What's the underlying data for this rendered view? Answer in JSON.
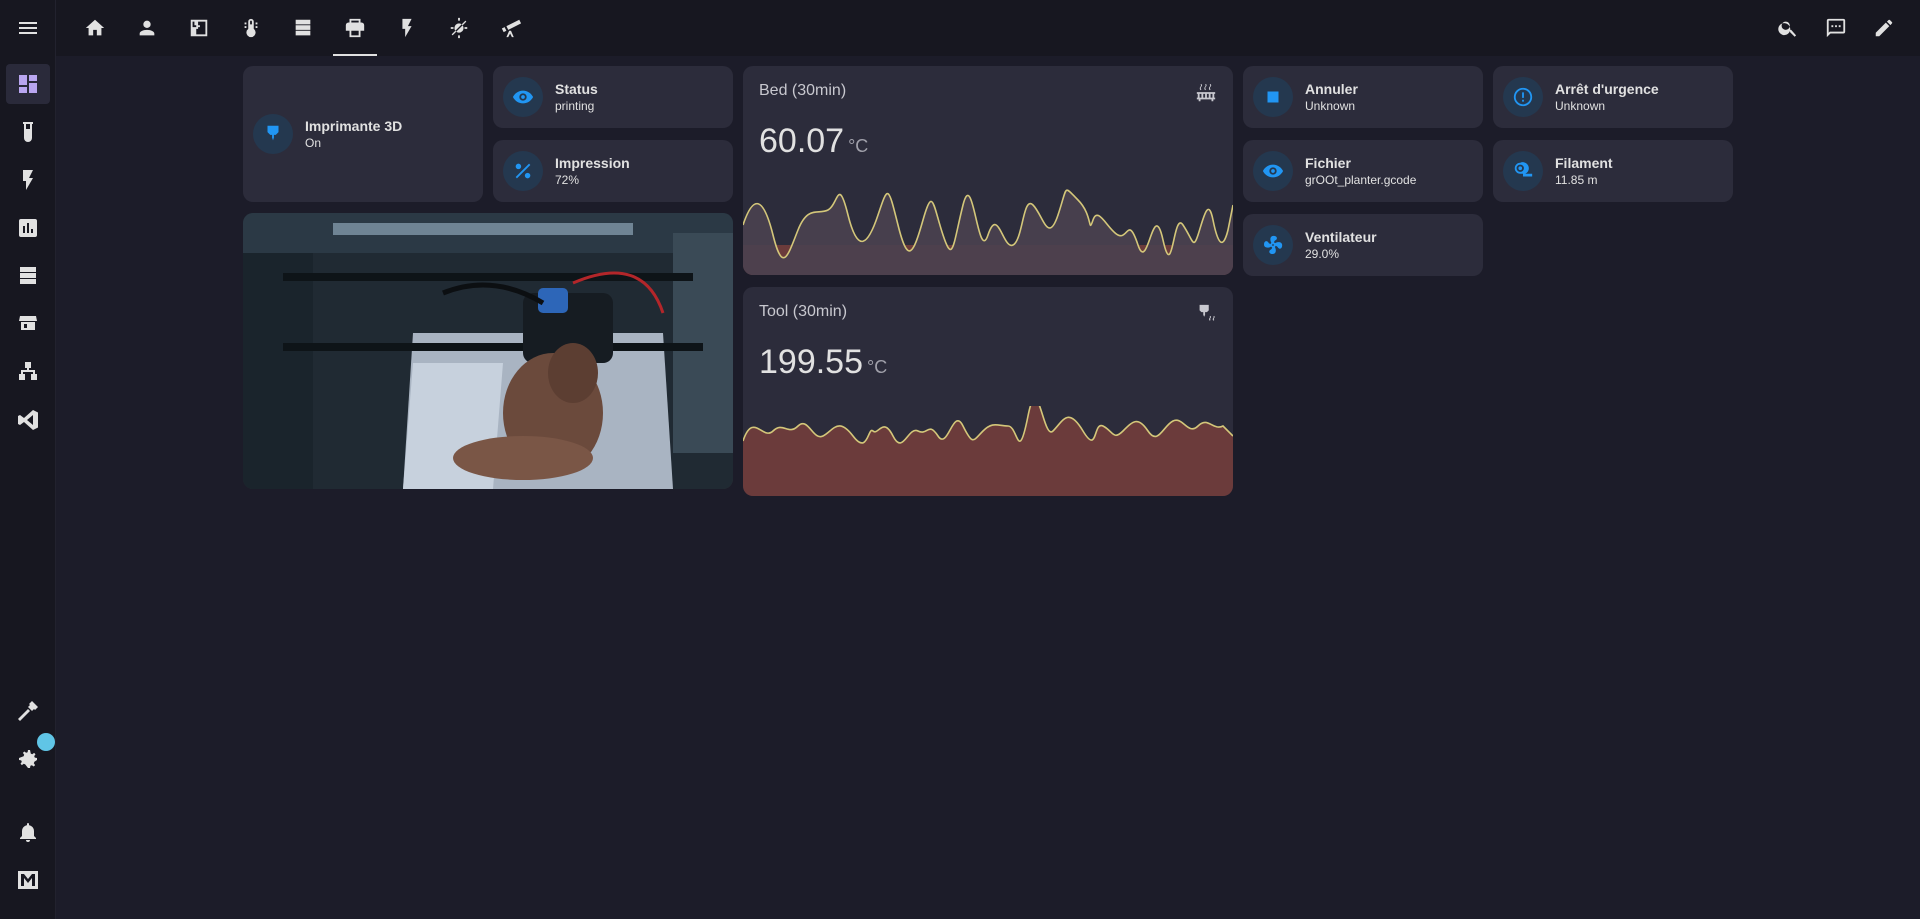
{
  "sidebar": {
    "items": [
      {
        "icon": "menu-icon"
      },
      {
        "icon": "dashboard-icon"
      },
      {
        "icon": "flask-icon"
      },
      {
        "icon": "lightning-icon"
      },
      {
        "icon": "chart-box-icon"
      },
      {
        "icon": "server-icon"
      },
      {
        "icon": "hacs-icon"
      },
      {
        "icon": "sitemap-icon"
      },
      {
        "icon": "vscode-icon"
      },
      {
        "icon": "hammer-icon"
      },
      {
        "icon": "gear-icon"
      },
      {
        "icon": "bell-icon"
      },
      {
        "icon": "user-avatar-icon"
      }
    ]
  },
  "topbar": {
    "tabs": [
      {
        "icon": "home-icon"
      },
      {
        "icon": "account-icon"
      },
      {
        "icon": "floor-plan-icon"
      },
      {
        "icon": "thermometer-icon"
      },
      {
        "icon": "server-icon"
      },
      {
        "icon": "printer-3d-icon"
      },
      {
        "icon": "lightning-icon"
      },
      {
        "icon": "weather-icon"
      },
      {
        "icon": "telescope-icon"
      }
    ],
    "active_tab": 5,
    "actions": [
      "search-icon",
      "comment-icon",
      "pencil-icon"
    ]
  },
  "tiles": {
    "printer": {
      "name": "Imprimante 3D",
      "state": "On"
    },
    "status": {
      "name": "Status",
      "state": "printing"
    },
    "impression": {
      "name": "Impression",
      "state": "72%"
    },
    "annuler": {
      "name": "Annuler",
      "state": "Unknown"
    },
    "arret": {
      "name": "Arrêt d'urgence",
      "state": "Unknown"
    },
    "fichier": {
      "name": "Fichier",
      "state": "grOOt_planter.gcode"
    },
    "filament": {
      "name": "Filament",
      "state": "11.85 m"
    },
    "ventilateur": {
      "name": "Ventilateur",
      "state": "29.0%"
    }
  },
  "graphs": {
    "bed": {
      "title": "Bed (30min)",
      "value": "60.07",
      "unit": "°C"
    },
    "tool": {
      "title": "Tool (30min)",
      "value": "199.55",
      "unit": "°C"
    }
  },
  "colors": {
    "accent": "#2196f3",
    "line": "#d4c77a",
    "fill_low": "#6b3b3b",
    "card": "#2c2c3b",
    "background": "#1c1c29"
  }
}
